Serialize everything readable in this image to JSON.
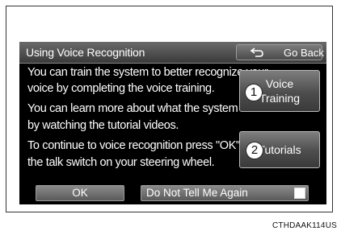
{
  "screen": {
    "title": "Using Voice Recognition",
    "back_label": "Go Back",
    "message_lines": [
      "You can train the system to better recognize your",
      "voice by completing the voice training.",
      "You can learn more about what the system can do",
      "by watching the tutorial videos.",
      "To continue to voice recognition press \"OK\" or",
      "the talk switch on your steering wheel."
    ],
    "voice_training_line1": "Voice",
    "voice_training_line2": "Training",
    "tutorials_label": "Tutorials",
    "ok_label": "OK",
    "dont_tell_label": "Do Not Tell Me Again"
  },
  "callouts": [
    "1",
    "2"
  ],
  "caption": "CTHDAAK114US",
  "colors": {
    "screen_bg": "#000000",
    "button_gradient_top": "#7e7e7e",
    "button_gradient_bottom": "#3a3a3a",
    "text": "#ffffff"
  },
  "icons": [
    "return-arrow-icon",
    "checkbox-icon"
  ]
}
